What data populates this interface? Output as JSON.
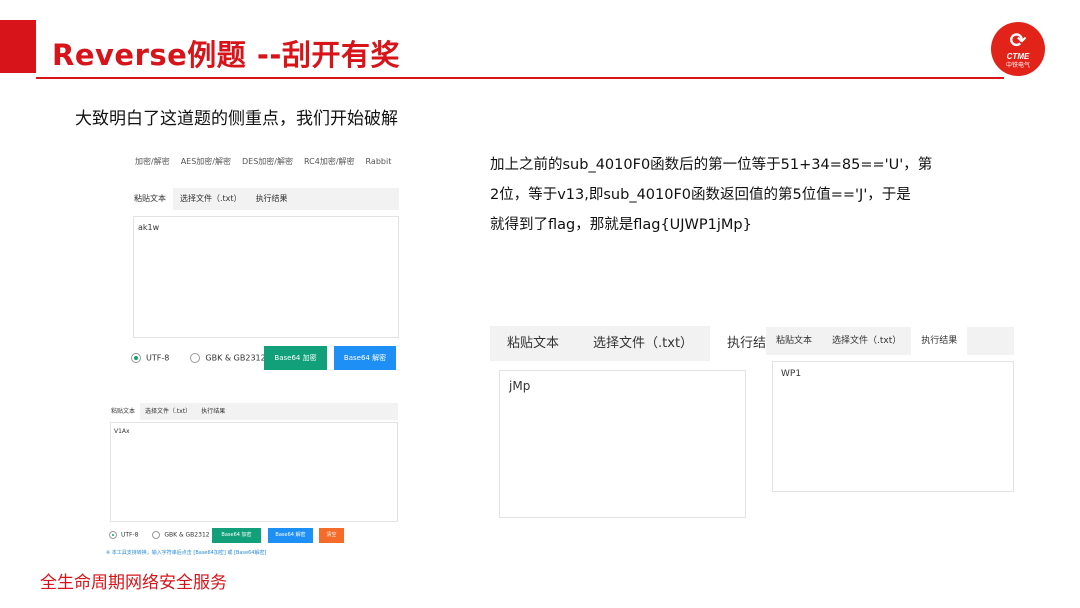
{
  "slide": {
    "title": "Reverse例题 --刮开有奖",
    "logo_text": "CTME",
    "logo_subtext": "中铁电气",
    "intro": "大致明白了这道题的侧重点，我们开始破解",
    "explanation": [
      "加上之前的sub_4010F0函数后的第一位等于51+34=85=='U'，第",
      "2位，等于v13,即sub_4010F0函数返回值的第5位值=='J'，于是",
      "就得到了flag，那就是flag{UJWP1jMp}"
    ],
    "footer": "全生命周期网络安全服务"
  },
  "tool1": {
    "menu": [
      "加密/解密",
      "AES加密/解密",
      "DES加密/解密",
      "RC4加密/解密",
      "Rabbit"
    ],
    "tabs": [
      "粘贴文本",
      "选择文件（.txt）",
      "执行结果"
    ],
    "input": "ak1w",
    "radio_utf8": "UTF-8",
    "radio_gbk": "GBK & GB2312",
    "encode_button": "Base64 加密",
    "decode_button": "Base64 解密"
  },
  "tool2": {
    "tabs": [
      "粘贴文本",
      "选择文件（.txt）",
      "执行结果"
    ],
    "input": "V1Ax",
    "radio_utf8": "UTF-8",
    "radio_gbk": "GBK & GB2312",
    "encode_button": "Base64 加密",
    "decode_button": "Base64 解密",
    "clear_button": "清空",
    "tip": "※ 本工具支持转换，输入字符串后点击 [Base64加密] 或 [Base64解密]"
  },
  "tool3": {
    "tabs": [
      "粘贴文本",
      "选择文件（.txt）",
      "执行结果"
    ],
    "result": "jMp"
  },
  "tool4": {
    "tabs": [
      "粘贴文本",
      "选择文件（.txt）",
      "执行结果"
    ],
    "result": "WP1"
  },
  "colors": {
    "brand_red": "#d7141a",
    "teal_button": "#12a07a",
    "blue_button": "#1e90f5",
    "orange_button": "#f56b2a"
  }
}
